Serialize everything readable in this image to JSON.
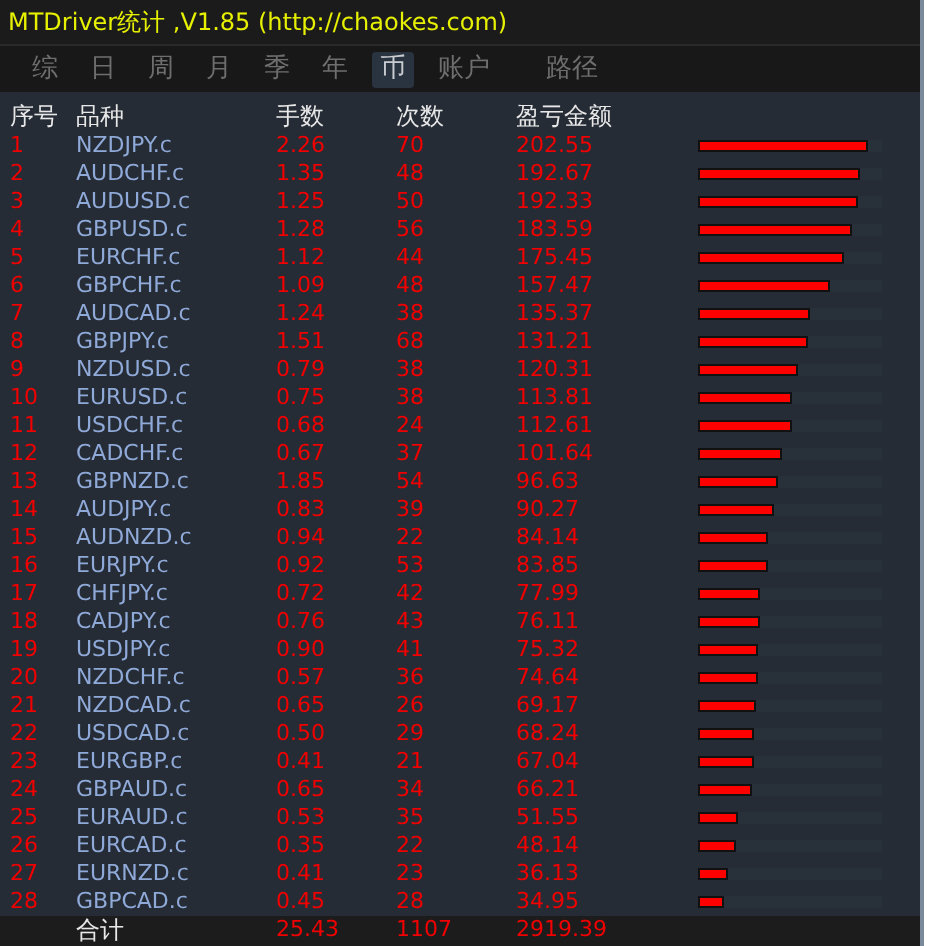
{
  "window": {
    "title": "MTDriver统计 ,V1.85 (http://chaokes.com)"
  },
  "tabs": [
    {
      "label": "综",
      "selected": false
    },
    {
      "label": "日",
      "selected": false
    },
    {
      "label": "周",
      "selected": false
    },
    {
      "label": "月",
      "selected": false
    },
    {
      "label": "季",
      "selected": false
    },
    {
      "label": "年",
      "selected": false
    },
    {
      "label": "币",
      "selected": true
    },
    {
      "label": "账户",
      "selected": false
    },
    {
      "label": "路径",
      "selected": false
    }
  ],
  "table": {
    "columns": [
      "序号",
      "品种",
      "手数",
      "次数",
      "盈亏金额"
    ],
    "rows": [
      {
        "no": "1",
        "symbol": "NZDJPY.c",
        "lots": "2.26",
        "count": "70",
        "profit": "202.55",
        "level": 0.92
      },
      {
        "no": "2",
        "symbol": "AUDCHF.c",
        "lots": "1.35",
        "count": "48",
        "profit": "192.67",
        "level": 0.88
      },
      {
        "no": "3",
        "symbol": "AUDUSD.c",
        "lots": "1.25",
        "count": "50",
        "profit": "192.33",
        "level": 0.87
      },
      {
        "no": "4",
        "symbol": "GBPUSD.c",
        "lots": "1.28",
        "count": "56",
        "profit": "183.59",
        "level": 0.84
      },
      {
        "no": "5",
        "symbol": "EURCHF.c",
        "lots": "1.12",
        "count": "44",
        "profit": "175.45",
        "level": 0.79
      },
      {
        "no": "6",
        "symbol": "GBPCHF.c",
        "lots": "1.09",
        "count": "48",
        "profit": "157.47",
        "level": 0.72
      },
      {
        "no": "7",
        "symbol": "AUDCAD.c",
        "lots": "1.24",
        "count": "38",
        "profit": "135.37",
        "level": 0.61
      },
      {
        "no": "8",
        "symbol": "GBPJPY.c",
        "lots": "1.51",
        "count": "68",
        "profit": "131.21",
        "level": 0.6
      },
      {
        "no": "9",
        "symbol": "NZDUSD.c",
        "lots": "0.79",
        "count": "38",
        "profit": "120.31",
        "level": 0.54
      },
      {
        "no": "10",
        "symbol": "EURUSD.c",
        "lots": "0.75",
        "count": "38",
        "profit": "113.81",
        "level": 0.51
      },
      {
        "no": "11",
        "symbol": "USDCHF.c",
        "lots": "0.68",
        "count": "24",
        "profit": "112.61",
        "level": 0.51
      },
      {
        "no": "12",
        "symbol": "CADCHF.c",
        "lots": "0.67",
        "count": "37",
        "profit": "101.64",
        "level": 0.46
      },
      {
        "no": "13",
        "symbol": "GBPNZD.c",
        "lots": "1.85",
        "count": "54",
        "profit": "96.63",
        "level": 0.43
      },
      {
        "no": "14",
        "symbol": "AUDJPY.c",
        "lots": "0.83",
        "count": "39",
        "profit": "90.27",
        "level": 0.41
      },
      {
        "no": "15",
        "symbol": "AUDNZD.c",
        "lots": "0.94",
        "count": "22",
        "profit": "84.14",
        "level": 0.38
      },
      {
        "no": "16",
        "symbol": "EURJPY.c",
        "lots": "0.92",
        "count": "53",
        "profit": "83.85",
        "level": 0.38
      },
      {
        "no": "17",
        "symbol": "CHFJPY.c",
        "lots": "0.72",
        "count": "42",
        "profit": "77.99",
        "level": 0.34
      },
      {
        "no": "18",
        "symbol": "CADJPY.c",
        "lots": "0.76",
        "count": "43",
        "profit": "76.11",
        "level": 0.34
      },
      {
        "no": "19",
        "symbol": "USDJPY.c",
        "lots": "0.90",
        "count": "41",
        "profit": "75.32",
        "level": 0.33
      },
      {
        "no": "20",
        "symbol": "NZDCHF.c",
        "lots": "0.57",
        "count": "36",
        "profit": "74.64",
        "level": 0.33
      },
      {
        "no": "21",
        "symbol": "NZDCAD.c",
        "lots": "0.65",
        "count": "26",
        "profit": "69.17",
        "level": 0.31
      },
      {
        "no": "22",
        "symbol": "USDCAD.c",
        "lots": "0.50",
        "count": "29",
        "profit": "68.24",
        "level": 0.3
      },
      {
        "no": "23",
        "symbol": "EURGBP.c",
        "lots": "0.41",
        "count": "21",
        "profit": "67.04",
        "level": 0.3
      },
      {
        "no": "24",
        "symbol": "GBPAUD.c",
        "lots": "0.65",
        "count": "34",
        "profit": "66.21",
        "level": 0.29
      },
      {
        "no": "25",
        "symbol": "EURAUD.c",
        "lots": "0.53",
        "count": "35",
        "profit": "51.55",
        "level": 0.22
      },
      {
        "no": "26",
        "symbol": "EURCAD.c",
        "lots": "0.35",
        "count": "22",
        "profit": "48.14",
        "level": 0.21
      },
      {
        "no": "27",
        "symbol": "EURNZD.c",
        "lots": "0.41",
        "count": "23",
        "profit": "36.13",
        "level": 0.16
      },
      {
        "no": "28",
        "symbol": "GBPCAD.c",
        "lots": "0.45",
        "count": "28",
        "profit": "34.95",
        "level": 0.14
      }
    ],
    "total": {
      "label": "合计",
      "lots": "25.43",
      "count": "1107",
      "profit": "2919.39"
    }
  }
}
